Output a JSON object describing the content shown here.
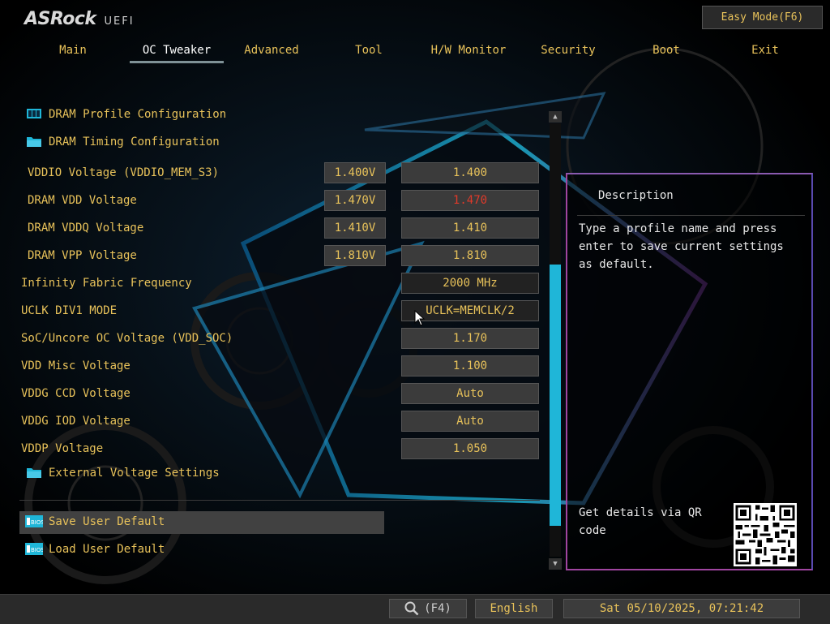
{
  "header": {
    "brand": "ASRock",
    "brand_suffix": "UEFI",
    "easy_mode": "Easy Mode(F6)"
  },
  "tabs": [
    {
      "label": "Main"
    },
    {
      "label": "OC Tweaker",
      "active": true
    },
    {
      "label": "Advanced"
    },
    {
      "label": "Tool"
    },
    {
      "label": "H/W Monitor"
    },
    {
      "label": "Security"
    },
    {
      "label": "Boot"
    },
    {
      "label": "Exit"
    }
  ],
  "menu": {
    "dram_profile": "DRAM Profile Configuration",
    "dram_timing": "DRAM Timing Configuration",
    "vddio": {
      "label": "VDDIO Voltage (VDDIO_MEM_S3)",
      "current": "1.400V",
      "value": "1.400"
    },
    "dram_vdd": {
      "label": "DRAM VDD Voltage",
      "current": "1.470V",
      "value": "1.470"
    },
    "dram_vddq": {
      "label": "DRAM VDDQ Voltage",
      "current": "1.410V",
      "value": "1.410"
    },
    "dram_vpp": {
      "label": "DRAM VPP Voltage",
      "current": "1.810V",
      "value": "1.810"
    },
    "infinity_fabric": {
      "label": "Infinity Fabric Frequency",
      "value": "2000 MHz"
    },
    "uclk": {
      "label": "UCLK DIV1 MODE",
      "value": "UCLK=MEMCLK/2"
    },
    "soc_voltage": {
      "label": "SoC/Uncore OC Voltage (VDD_SOC)",
      "value": "1.170"
    },
    "vdd_misc": {
      "label": "VDD Misc Voltage",
      "value": "1.100"
    },
    "vddg_ccd": {
      "label": "VDDG CCD Voltage",
      "value": "Auto"
    },
    "vddg_iod": {
      "label": "VDDG IOD Voltage",
      "value": "Auto"
    },
    "vddp": {
      "label": "VDDP Voltage",
      "value": "1.050"
    },
    "external_voltage": "External Voltage Settings",
    "save_user_default": "Save User Default",
    "load_user_default": "Load User Default"
  },
  "description": {
    "title": "Description",
    "text": "Type a profile name and press enter to save current settings as default.",
    "qr_text": "Get details via QR code"
  },
  "footer": {
    "search": "(F4)",
    "language": "English",
    "datetime": "Sat 05/10/2025, 07:21:42"
  },
  "colors": {
    "text": "#e8c25a",
    "accent": "#1fb6d8",
    "warning": "#e03a2a",
    "panel_border": "#a045a0"
  },
  "icons": [
    "dram-profile-icon",
    "folder-icon",
    "bios-icon",
    "search-icon",
    "qr-code-icon",
    "scroll-up-icon",
    "scroll-down-icon",
    "mouse-pointer-icon"
  ]
}
